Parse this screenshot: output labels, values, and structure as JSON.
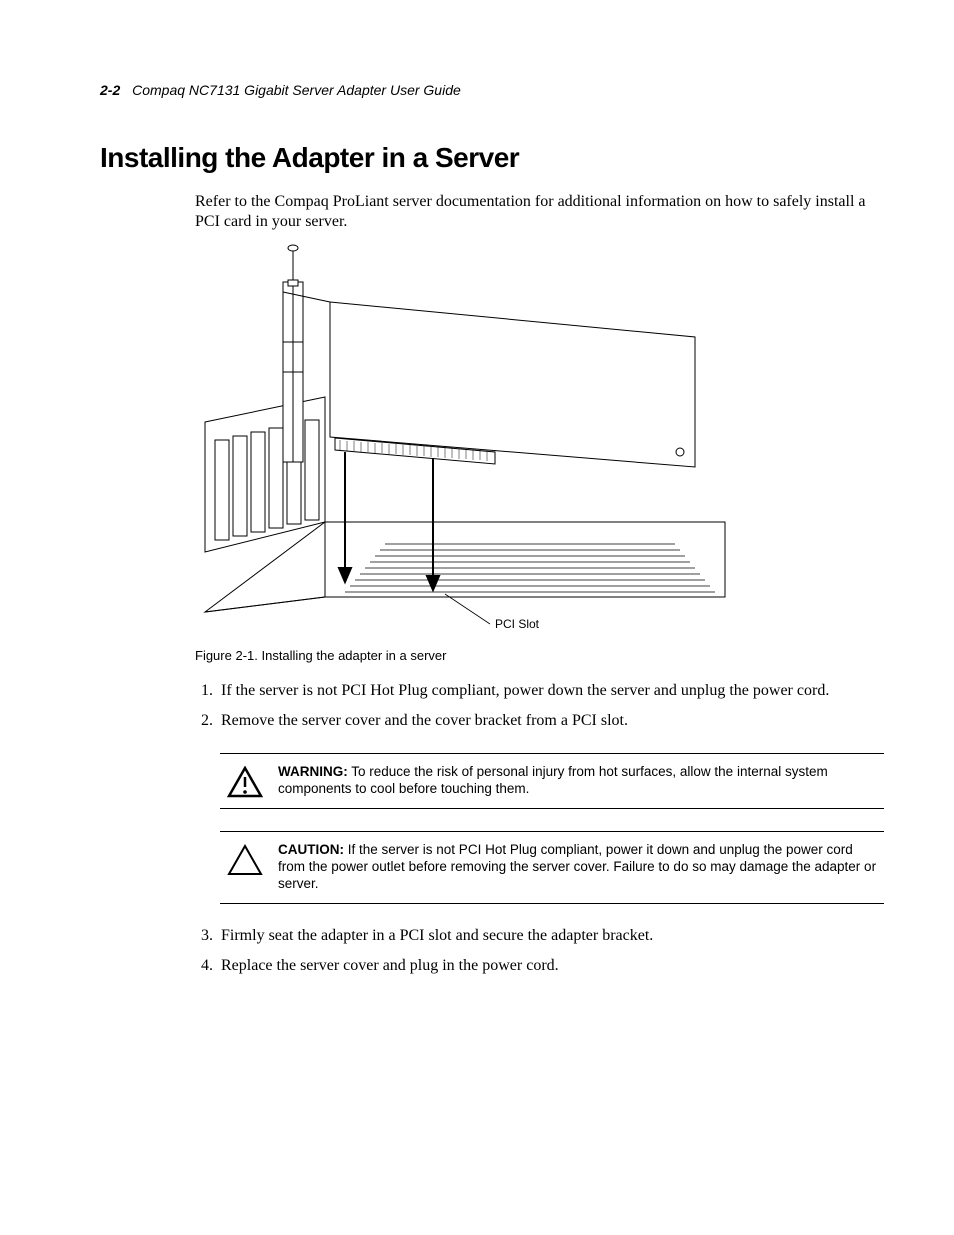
{
  "header": {
    "page_number": "2-2",
    "book_title": "Compaq NC7131 Gigabit Server Adapter User Guide"
  },
  "section_title": "Installing the Adapter in a Server",
  "intro": "Refer to the Compaq ProLiant server documentation for additional information on how to safely install a PCI card in your server.",
  "figure": {
    "callout": "PCI Slot",
    "caption": "Figure 2-1.  Installing the adapter in a server"
  },
  "steps": {
    "s1": "If the server is not PCI Hot Plug compliant, power down the server and unplug the power cord.",
    "s2": "Remove the server cover and the cover bracket from a PCI slot.",
    "s3": "Firmly seat the adapter in a PCI slot and secure the adapter bracket.",
    "s4": "Replace the server cover and plug in the power cord."
  },
  "warning": {
    "label": "WARNING:",
    "text": "To reduce the risk of personal injury from hot surfaces, allow the internal system components to cool before touching them."
  },
  "caution": {
    "label": "CAUTION:",
    "text": "If the server is not PCI Hot Plug compliant, power it down and unplug the power cord from the power outlet before removing the server cover. Failure to do so may damage the adapter or server."
  }
}
